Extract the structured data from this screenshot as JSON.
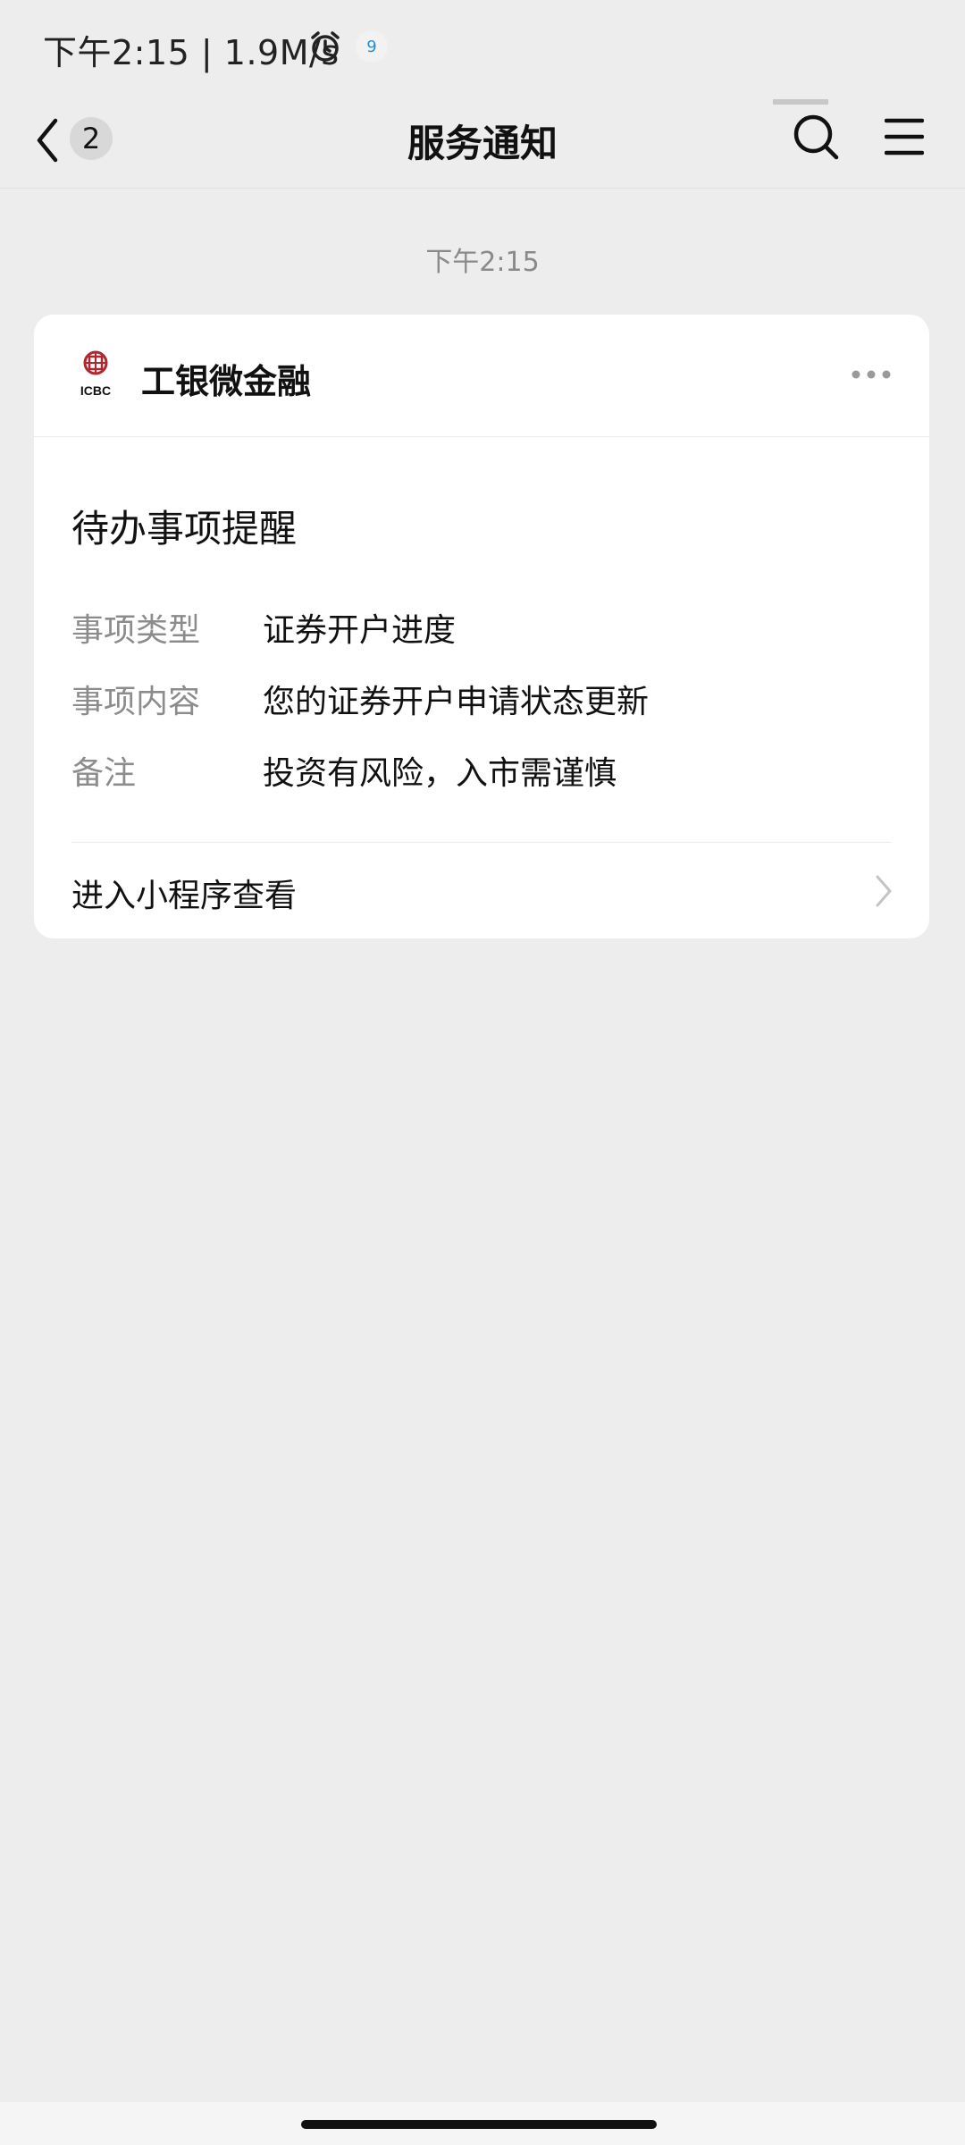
{
  "status_bar": {
    "text": "下午2:15 | 1.9M/s",
    "calendar_day": "9"
  },
  "nav": {
    "unread_count": "2",
    "title": "服务通知"
  },
  "timestamp": "下午2:15",
  "card": {
    "mp_name": "工银微金融",
    "logo_text": "ICBC",
    "title": "待办事项提醒",
    "fields": [
      {
        "label": "事项类型",
        "value": "证券开户进度"
      },
      {
        "label": "事项内容",
        "value": "您的证券开户申请状态更新"
      },
      {
        "label": "备注",
        "value": "投资有风险，入市需谨慎"
      }
    ],
    "open_link": "进入小程序查看"
  },
  "colors": {
    "background": "#ededed",
    "card": "#ffffff",
    "icbc_red": "#b0272f"
  }
}
